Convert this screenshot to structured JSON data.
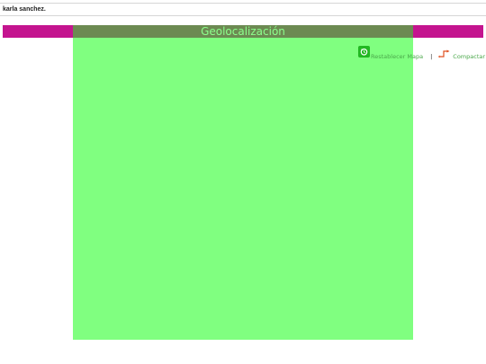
{
  "user": {
    "name": "karla sanchez."
  },
  "map": {
    "title": "Geolocalización",
    "reset_label": "Restablecer Mapa",
    "separator": "|",
    "compact_label": "Compactar"
  },
  "colors": {
    "title_band": "#c4148f",
    "map_overlay": "#80ff80",
    "map_title_strip": "#6c8a52",
    "reset_icon": "#22b822",
    "link_text": "#4aa84a",
    "compact_icon": "#e05020"
  },
  "icons": {
    "reset": "reset-map-icon",
    "compact": "compact-icon"
  }
}
